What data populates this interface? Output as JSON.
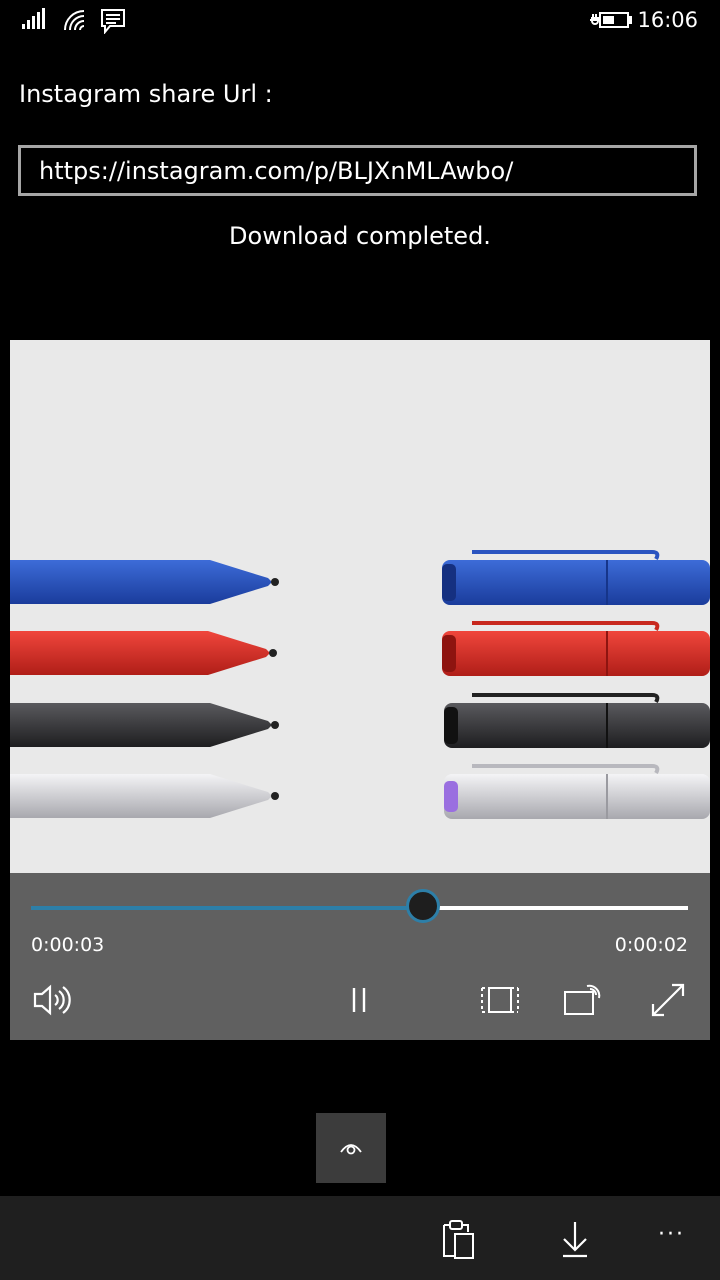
{
  "status_bar": {
    "time": "16:06",
    "icons": [
      "signal-icon",
      "wifi-icon",
      "message-icon",
      "battery-charging-icon"
    ]
  },
  "share": {
    "label": "Instagram share Url :",
    "url_value": "https://instagram.com/p/BLJXnMLAwbo/"
  },
  "download": {
    "status": "Download completed."
  },
  "player": {
    "elapsed": "0:00:03",
    "remaining": "0:00:02",
    "progress_fraction": 0.6,
    "controls": [
      "volume-icon",
      "pause-icon",
      "zoom-icon",
      "cast-icon",
      "fullscreen-icon"
    ]
  },
  "app_bar": {
    "buttons": [
      "eye-icon",
      "paste-icon",
      "download-icon",
      "more-icon"
    ],
    "more_label": "···"
  },
  "colors": {
    "accent": "#2d7fa8",
    "background": "#000000",
    "player_bar": "#606060",
    "app_bar": "#1f1f1f"
  }
}
